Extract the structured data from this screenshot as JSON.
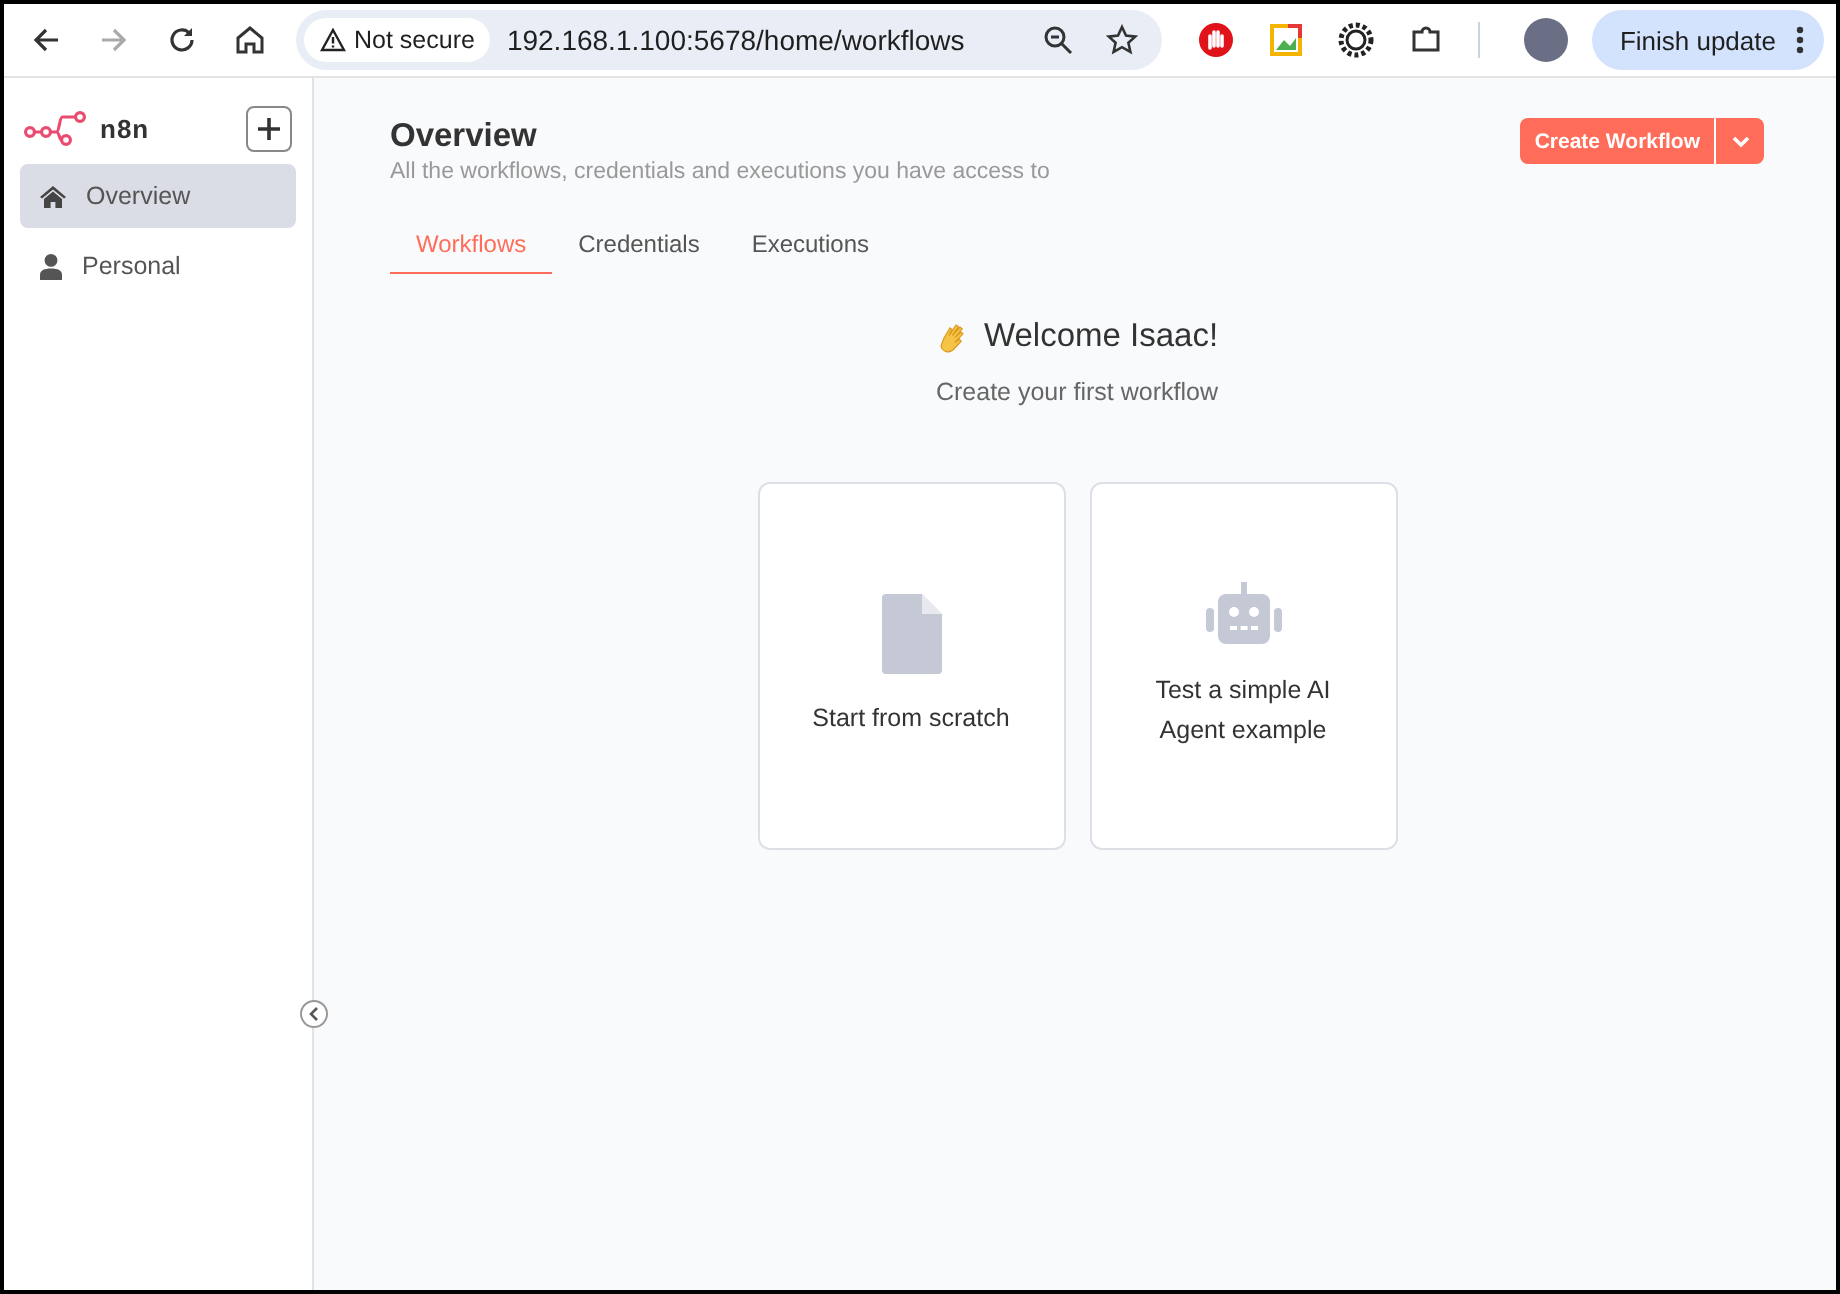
{
  "browser": {
    "security": "Not secure",
    "url": "192.168.1.100:5678/home/workflows",
    "update_button": "Finish update"
  },
  "sidebar": {
    "logo": "n8n",
    "items": [
      {
        "label": "Overview",
        "kind": "home",
        "selected": true
      },
      {
        "label": "Personal",
        "kind": "person",
        "selected": false
      }
    ]
  },
  "header": {
    "title": "Overview",
    "subtitle": "All the workflows, credentials and executions you have access to",
    "create_button": "Create Workflow"
  },
  "tabs": [
    {
      "label": "Workflows",
      "selected": true
    },
    {
      "label": "Credentials",
      "selected": false
    },
    {
      "label": "Executions",
      "selected": false
    }
  ],
  "welcome": {
    "title": "Welcome Isaac!",
    "subtitle": "Create your first workflow"
  },
  "cards": [
    {
      "label": "Start from scratch",
      "kind": "file"
    },
    {
      "label": "Test a simple AI Agent example",
      "kind": "robot"
    }
  ]
}
